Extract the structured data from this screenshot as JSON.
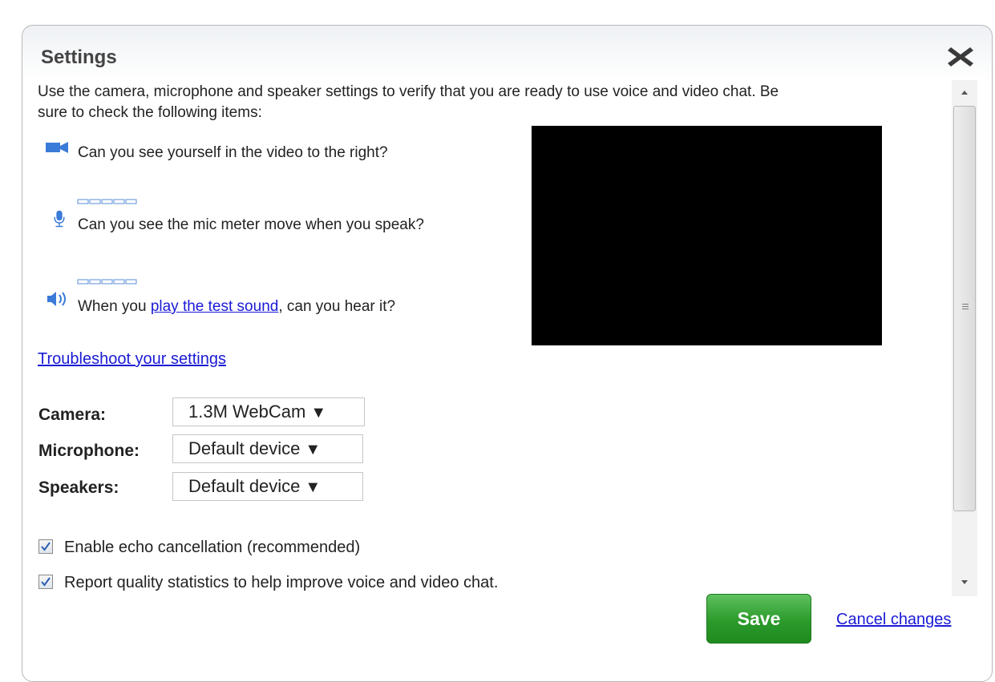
{
  "dialog": {
    "title": "Settings",
    "close_icon": "close-icon"
  },
  "intro": {
    "line1": "Use the camera, microphone and speaker settings to verify that you are ready to use voice and video chat. Be",
    "line2": "sure to check the following items:"
  },
  "checks": {
    "camera_text": "Can you see yourself in the video to the right?",
    "mic_text": "Can you see the mic meter move when you speak?",
    "speaker_prefix": "When you ",
    "speaker_link": "play the test sound",
    "speaker_suffix": ", can you hear it?"
  },
  "troubleshoot_link": "Troubleshoot your settings",
  "devices": {
    "camera_label": "Camera:",
    "camera_value": "1.3M WebCam",
    "microphone_label": "Microphone:",
    "microphone_value": "Default device",
    "speakers_label": "Speakers:",
    "speakers_value": "Default device",
    "dropdown_arrow": "▼"
  },
  "options": {
    "echo_label": "Enable echo cancellation (recommended)",
    "echo_checked": true,
    "stats_label": "Report quality statistics to help improve voice and video chat.",
    "stats_checked": true
  },
  "footer": {
    "save_label": "Save",
    "cancel_label": "Cancel changes"
  },
  "colors": {
    "link": "#1a1ad6",
    "save_green": "#2b9a2b",
    "icon_blue": "#3a7ad8",
    "video_bg": "#000000"
  }
}
